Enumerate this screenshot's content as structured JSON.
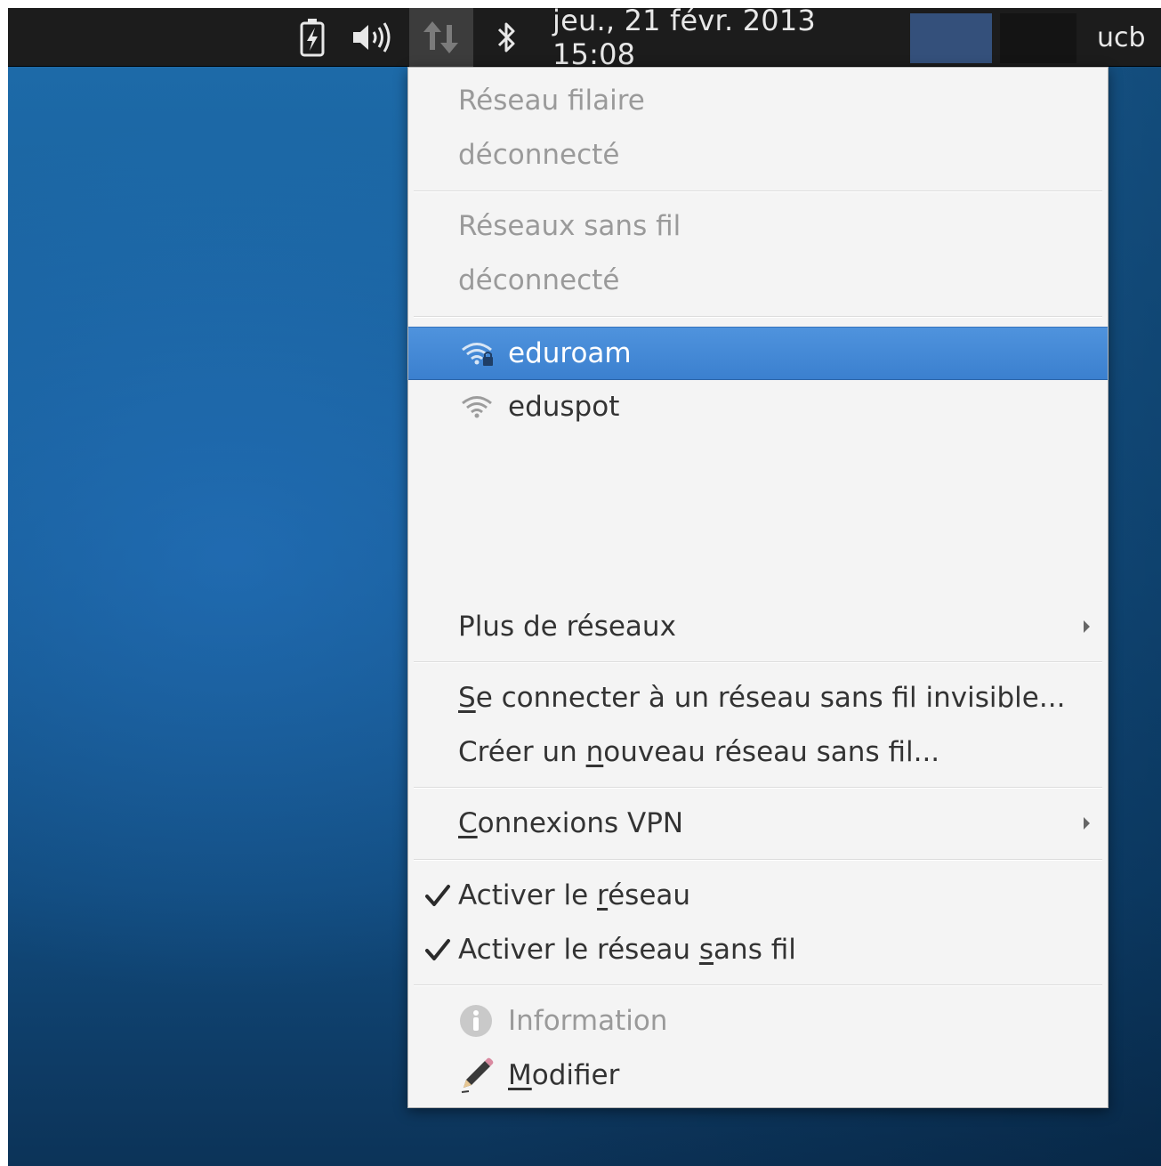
{
  "panel": {
    "clock": "jeu., 21 févr. 2013 15:08",
    "user": "ucb",
    "icons": [
      "battery-charging-icon",
      "volume-icon",
      "network-updown-icon",
      "bluetooth-icon"
    ]
  },
  "menu": {
    "wired_header": "Réseau filaire",
    "wired_status": "déconnecté",
    "wireless_header": "Réseaux sans fil",
    "wireless_status": "déconnecté",
    "networks": [
      {
        "name": "eduroam",
        "secured": true,
        "selected": true
      },
      {
        "name": "eduspot",
        "secured": false,
        "selected": false
      }
    ],
    "more_networks": "Plus de réseaux",
    "connect_hidden": {
      "mnemonic": "S",
      "rest": "e connecter à un réseau sans fil invisible..."
    },
    "create_new": {
      "before": "Créer un ",
      "mnemonic": "n",
      "after": "ouveau réseau sans fil..."
    },
    "vpn": {
      "mnemonic": "C",
      "rest": "onnexions VPN"
    },
    "enable_network": {
      "before": "Activer le ",
      "mnemonic": "r",
      "after": "éseau",
      "checked": true
    },
    "enable_wireless": {
      "before": "Activer le réseau ",
      "mnemonic": "s",
      "after": "ans fil",
      "checked": true
    },
    "information": "Information",
    "edit": {
      "mnemonic": "M",
      "rest": "odifier"
    }
  },
  "colors": {
    "selection": "#3b80cf",
    "panel_bg": "#1c1c1c",
    "workspace_active": "#34507b",
    "desktop": "#165a93"
  }
}
